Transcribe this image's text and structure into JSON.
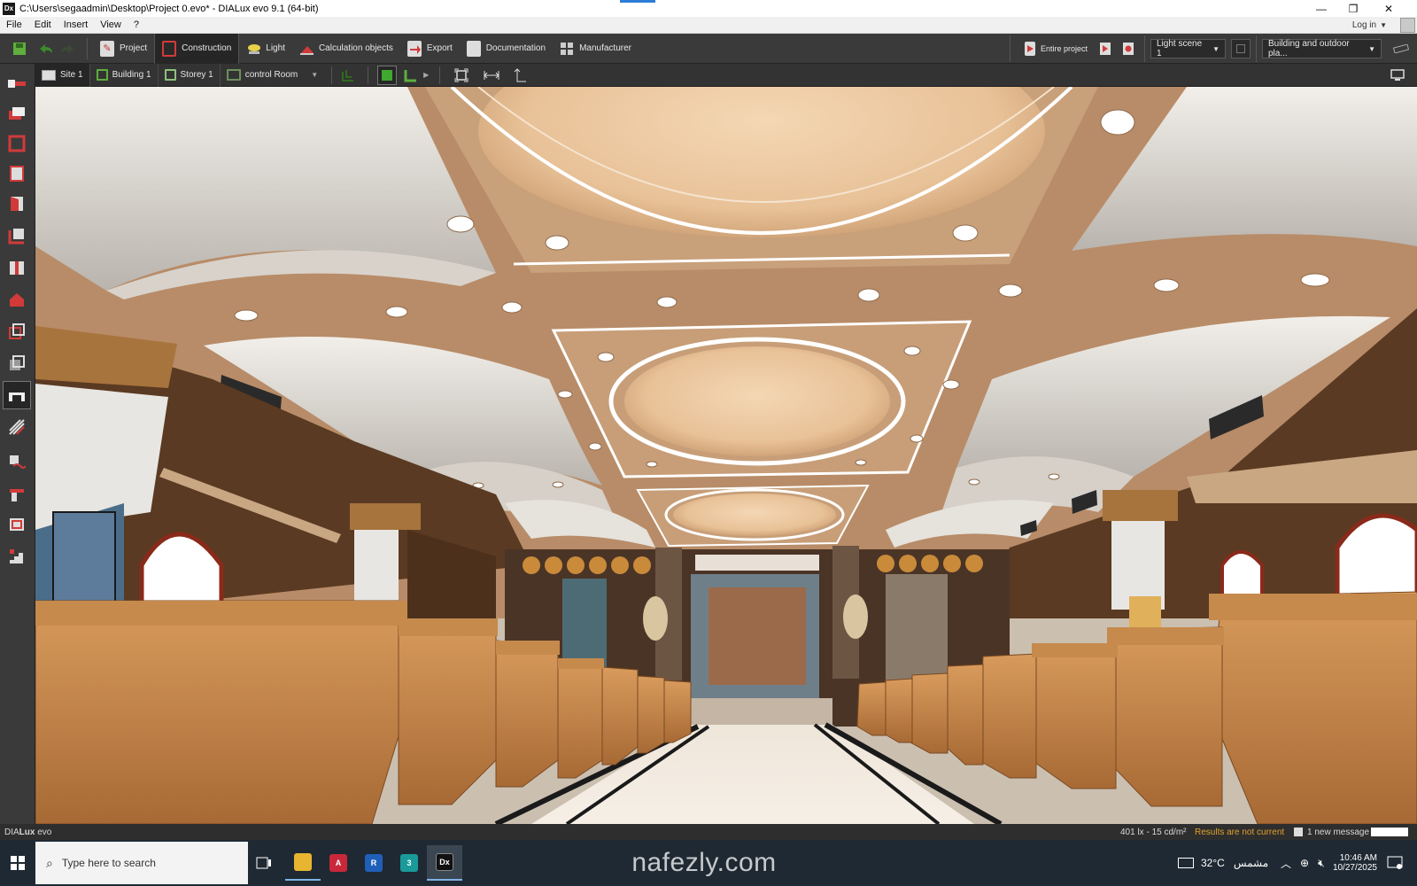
{
  "window": {
    "title": "C:\\Users\\segaadmin\\Desktop\\Project 0.evo* - DIALux evo 9.1  (64-bit)",
    "app_icon": "Dx",
    "minimize": "—",
    "restore": "❐",
    "close": "✕"
  },
  "menu": {
    "items": [
      "File",
      "Edit",
      "Insert",
      "View",
      "?"
    ],
    "login": "Log in"
  },
  "toolbar": {
    "nav": [
      {
        "label": "Project",
        "icon": "project-icon"
      },
      {
        "label": "Construction",
        "icon": "construction-icon"
      },
      {
        "label": "Light",
        "icon": "light-icon"
      },
      {
        "label": "Calculation objects",
        "icon": "calculation-objects-icon"
      },
      {
        "label": "Export",
        "icon": "export-icon"
      },
      {
        "label": "Documentation",
        "icon": "documentation-icon"
      },
      {
        "label": "Manufacturer",
        "icon": "manufacturer-icon"
      }
    ],
    "active": "Construction",
    "entire_project": "Entire project",
    "light_scene": "Light scene 1",
    "view_mode": "Building and outdoor pla..."
  },
  "breadcrumb": {
    "items": [
      "Site 1",
      "Building 1",
      "Storey 1",
      "control Room"
    ]
  },
  "left_tools": [
    "select-icon",
    "import-icon",
    "room-icon",
    "wall-icon",
    "door-icon",
    "floor-icon",
    "column-icon",
    "roof-icon",
    "cube-icon",
    "object-icon",
    "ceiling-tool-icon",
    "hatch-icon",
    "cut-icon",
    "beam-icon",
    "window-icon",
    "stairs-icon"
  ],
  "status": {
    "logo_prefix": "DIA",
    "logo_bold": "Lux",
    "logo_suffix": " evo",
    "values": "401 lx - 15 cd/m²",
    "warning": "Results are not current",
    "messages": "1 new message"
  },
  "taskbar": {
    "search_placeholder": "Type here to search",
    "watermark": "nafezly.com",
    "weather": "32°C",
    "weather_desc": "مشمس",
    "time": "10:46 AM",
    "date": "10/27/2025",
    "apps": [
      {
        "name": "file-explorer-icon",
        "label": ""
      },
      {
        "name": "autocad-icon",
        "label": "A"
      },
      {
        "name": "revit-icon",
        "label": "R"
      },
      {
        "name": "3dsmax-icon",
        "label": "3"
      },
      {
        "name": "dialux-icon",
        "label": "Dx"
      }
    ]
  },
  "colors": {
    "ui_dark": "#3a3a3a",
    "accent_red": "#d23a3a",
    "accent_green": "#5fae3e",
    "warning_orange": "#e0a030",
    "ceiling_wood": "#b38a66",
    "pew_wood": "#c68a4c"
  }
}
